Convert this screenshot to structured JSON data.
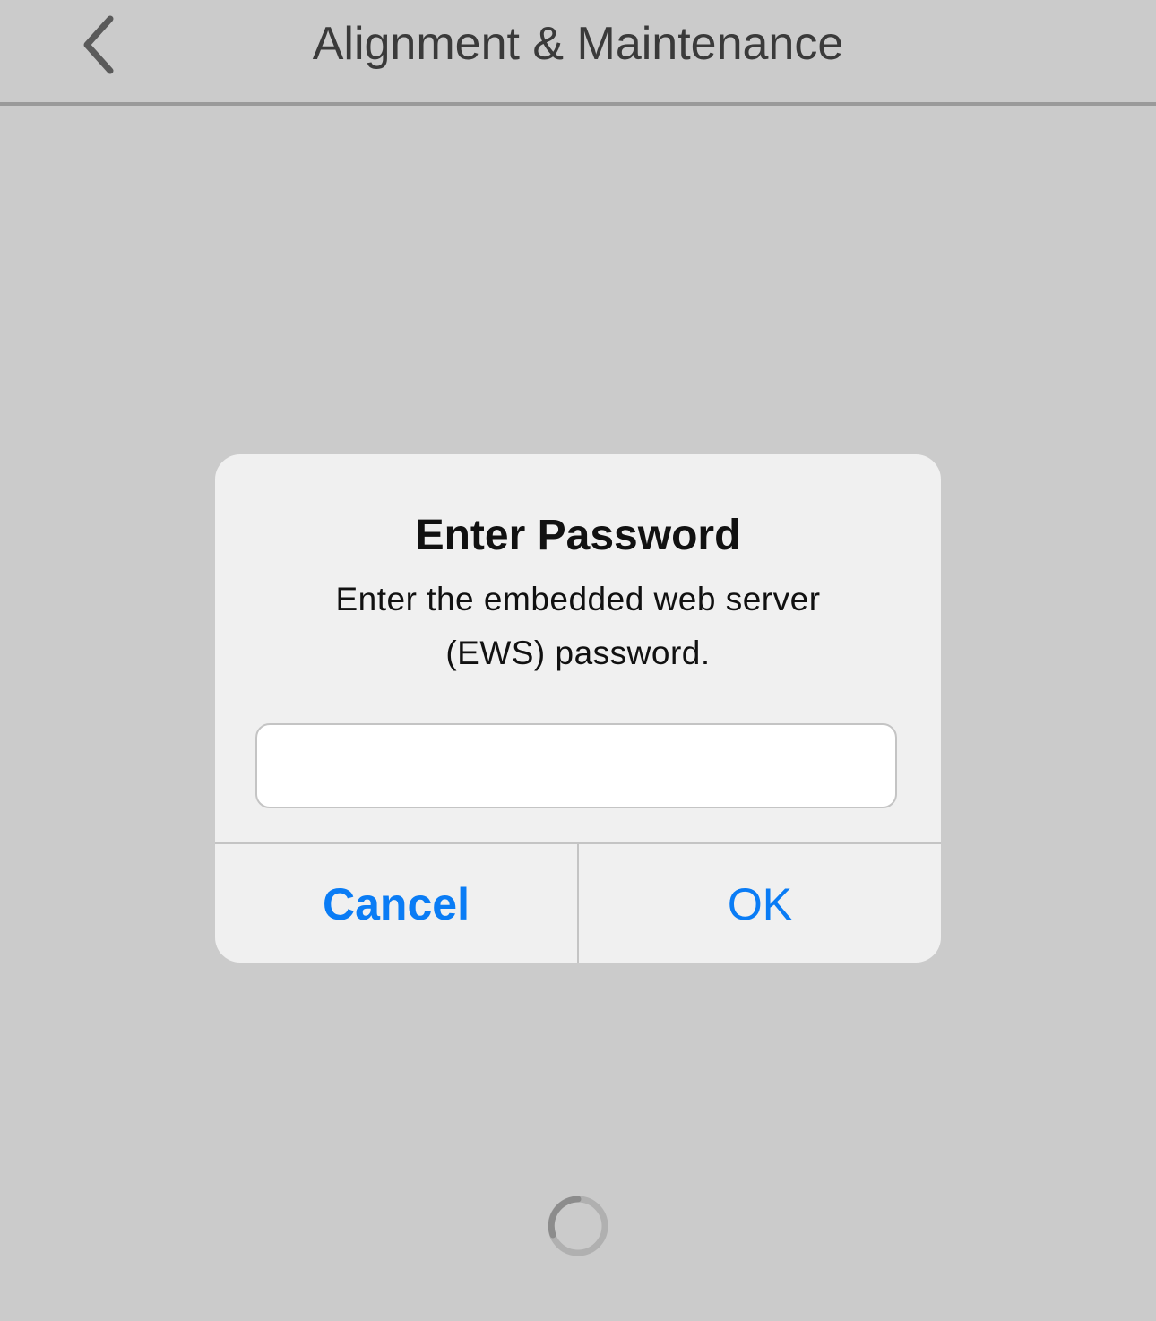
{
  "navbar": {
    "title": "Alignment & Maintenance",
    "back_icon": "chevron-left-icon"
  },
  "dialog": {
    "title": "Enter Password",
    "message": "Enter the embedded web server (EWS) password.",
    "password_value": "",
    "cancel_label": "Cancel",
    "ok_label": "OK"
  },
  "colors": {
    "background": "#cbcbcb",
    "dialog": "#f0f0f0",
    "accent": "#0a7cf5"
  },
  "status": {
    "spinner_icon": "loading-spinner-icon"
  }
}
